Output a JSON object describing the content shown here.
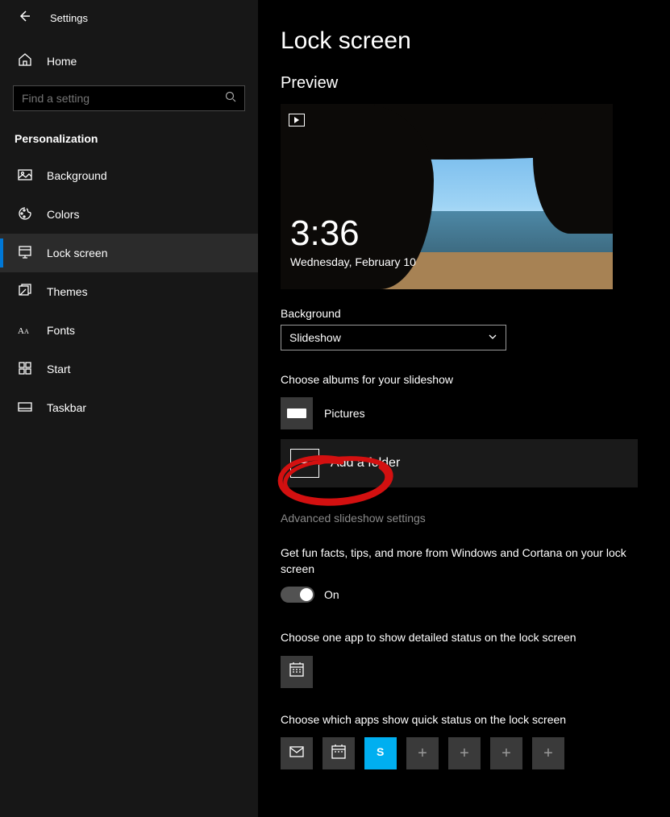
{
  "titlebar": {
    "title": "Settings"
  },
  "sidebar": {
    "home": "Home",
    "search_placeholder": "Find a setting",
    "category": "Personalization",
    "items": [
      {
        "label": "Background"
      },
      {
        "label": "Colors"
      },
      {
        "label": "Lock screen"
      },
      {
        "label": "Themes"
      },
      {
        "label": "Fonts"
      },
      {
        "label": "Start"
      },
      {
        "label": "Taskbar"
      }
    ]
  },
  "main": {
    "page_title": "Lock screen",
    "preview_label": "Preview",
    "preview_time": "3:36",
    "preview_date": "Wednesday, February 10",
    "background_label": "Background",
    "background_value": "Slideshow",
    "albums_label": "Choose albums for your slideshow",
    "albums": [
      {
        "name": "Pictures"
      }
    ],
    "add_folder": "Add a folder",
    "advanced_link": "Advanced slideshow settings",
    "fun_facts_text": "Get fun facts, tips, and more from Windows and Cortana on your lock screen",
    "fun_facts_state": "On",
    "detailed_label": "Choose one app to show detailed status on the lock screen",
    "quick_label": "Choose which apps show quick status on the lock screen"
  }
}
